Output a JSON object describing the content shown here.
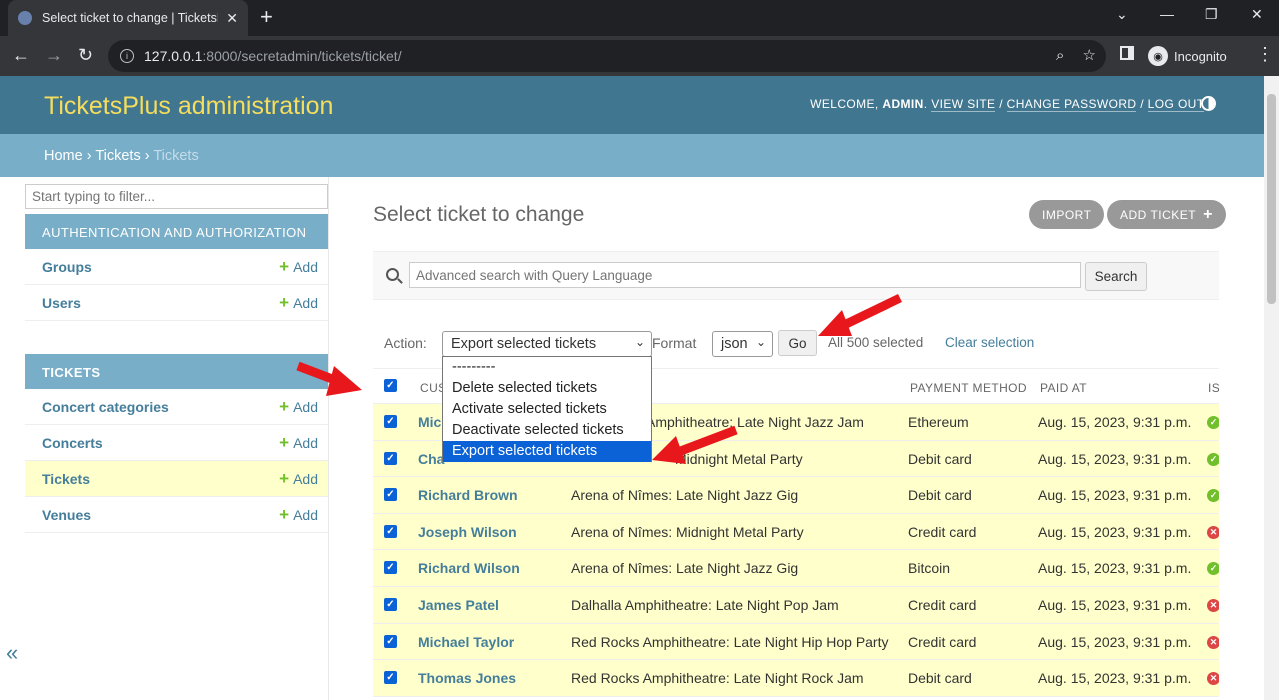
{
  "browser": {
    "tab_title": "Select ticket to change | TicketsPl",
    "url_host": "127.0.0.1",
    "url_path": ":8000/secretadmin/tickets/ticket/",
    "incognito_label": "Incognito"
  },
  "header": {
    "brand": "TicketsPlus administration",
    "welcome": "WELCOME,",
    "username": "ADMIN",
    "view_site": "VIEW SITE",
    "change_password": "CHANGE PASSWORD",
    "log_out": "LOG OUT"
  },
  "breadcrumbs": {
    "home": "Home",
    "app": "Tickets",
    "current": "Tickets"
  },
  "sidebar": {
    "filter_placeholder": "Start typing to filter...",
    "add_label": "Add",
    "modules": [
      {
        "caption": "AUTHENTICATION AND AUTHORIZATION",
        "models": [
          "Groups",
          "Users"
        ]
      },
      {
        "caption": "TICKETS",
        "models": [
          "Concert categories",
          "Concerts",
          "Tickets",
          "Venues"
        ]
      }
    ]
  },
  "content": {
    "title": "Select ticket to change",
    "import_label": "IMPORT",
    "add_ticket_label": "ADD TICKET",
    "search_placeholder": "Advanced search with Query Language",
    "search_button": "Search",
    "action_label": "Action:",
    "action_selected": "Export selected tickets",
    "format_label": "Format",
    "format_selected": "json",
    "go_button": "Go",
    "selected_count": "All 500 selected",
    "clear_selection": "Clear selection",
    "action_options": [
      "---------",
      "Delete selected tickets",
      "Activate selected tickets",
      "Deactivate selected tickets",
      "Export selected tickets"
    ]
  },
  "table": {
    "headers": [
      "CUS",
      "PAYMENT METHOD",
      "PAID AT",
      "IS"
    ],
    "rows": [
      {
        "customer": "Mic",
        "concert": "Amphitheatre: Late Night Jazz Jam",
        "payment": "Ethereum",
        "paid_at": "Aug. 15, 2023, 9:31 p.m.",
        "status": "ok"
      },
      {
        "customer": "Cha",
        "concert": "Midnight Metal Party",
        "payment": "Debit card",
        "paid_at": "Aug. 15, 2023, 9:31 p.m.",
        "status": "ok"
      },
      {
        "customer": "Richard Brown",
        "concert": "Arena of Nîmes: Late Night Jazz Gig",
        "payment": "Debit card",
        "paid_at": "Aug. 15, 2023, 9:31 p.m.",
        "status": "ok"
      },
      {
        "customer": "Joseph Wilson",
        "concert": "Arena of Nîmes: Midnight Metal Party",
        "payment": "Credit card",
        "paid_at": "Aug. 15, 2023, 9:31 p.m.",
        "status": "no"
      },
      {
        "customer": "Richard Wilson",
        "concert": "Arena of Nîmes: Late Night Jazz Gig",
        "payment": "Bitcoin",
        "paid_at": "Aug. 15, 2023, 9:31 p.m.",
        "status": "ok"
      },
      {
        "customer": "James Patel",
        "concert": "Dalhalla Amphitheatre: Late Night Pop Jam",
        "payment": "Credit card",
        "paid_at": "Aug. 15, 2023, 9:31 p.m.",
        "status": "no"
      },
      {
        "customer": "Michael Taylor",
        "concert": "Red Rocks Amphitheatre: Late Night Hip Hop Party",
        "payment": "Credit card",
        "paid_at": "Aug. 15, 2023, 9:31 p.m.",
        "status": "no"
      },
      {
        "customer": "Thomas Jones",
        "concert": "Red Rocks Amphitheatre: Late Night Rock Jam",
        "payment": "Debit card",
        "paid_at": "Aug. 15, 2023, 9:31 p.m.",
        "status": "no"
      }
    ]
  },
  "colors": {
    "header_bg": "#417690",
    "brand": "#f5dd5d",
    "breadcrumb_bg": "#79aec8",
    "link": "#447e9b",
    "selected_row": "#ffffcc",
    "annotation_arrow": "#e8171c"
  }
}
